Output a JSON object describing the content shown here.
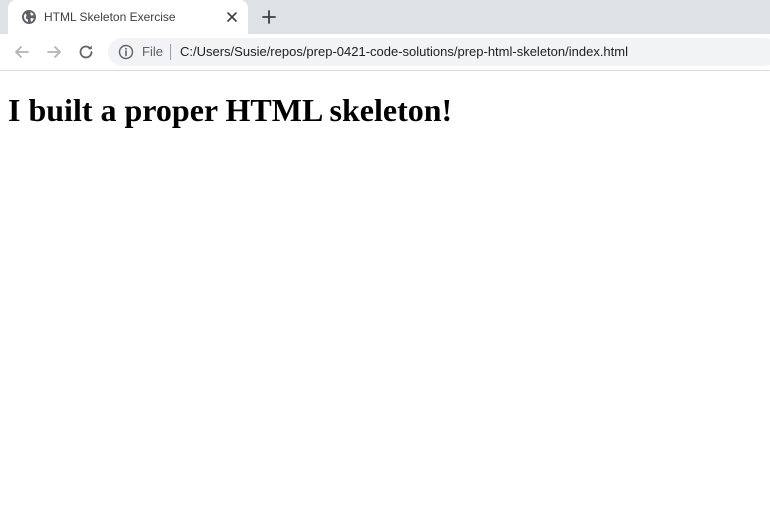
{
  "browser": {
    "tab": {
      "title": "HTML Skeleton Exercise",
      "favicon": "globe-icon",
      "close_icon": "close-icon"
    },
    "new_tab_icon": "plus-icon",
    "nav": {
      "back_icon": "arrow-left-icon",
      "forward_icon": "arrow-right-icon",
      "reload_icon": "reload-icon"
    },
    "omnibox": {
      "security_icon": "info-icon",
      "security_label": "File",
      "url": "C:/Users/Susie/repos/prep-0421-code-solutions/prep-html-skeleton/index.html"
    },
    "colors": {
      "tabstrip_bg": "#dee1e6",
      "omnibox_bg": "#f1f3f4",
      "icon_color": "#5f6368"
    }
  },
  "page": {
    "heading": "I built a proper HTML skeleton!"
  }
}
